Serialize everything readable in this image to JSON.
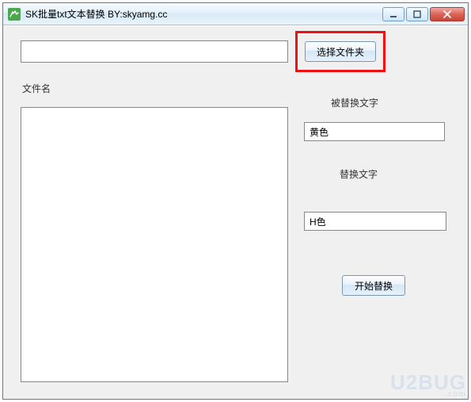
{
  "window": {
    "title": "SK批量txt文本替换 BY:skyamg.cc"
  },
  "path_value": "",
  "buttons": {
    "select_folder": "选择文件夹",
    "start": "开始替换"
  },
  "labels": {
    "filename": "文件名",
    "replaced_text": "被替换文字",
    "replace_text": "替换文字"
  },
  "inputs": {
    "replaced_value": "黄色",
    "replace_value": "H色"
  },
  "watermark": {
    "line1": "U2BUG",
    "line2": ".com"
  }
}
